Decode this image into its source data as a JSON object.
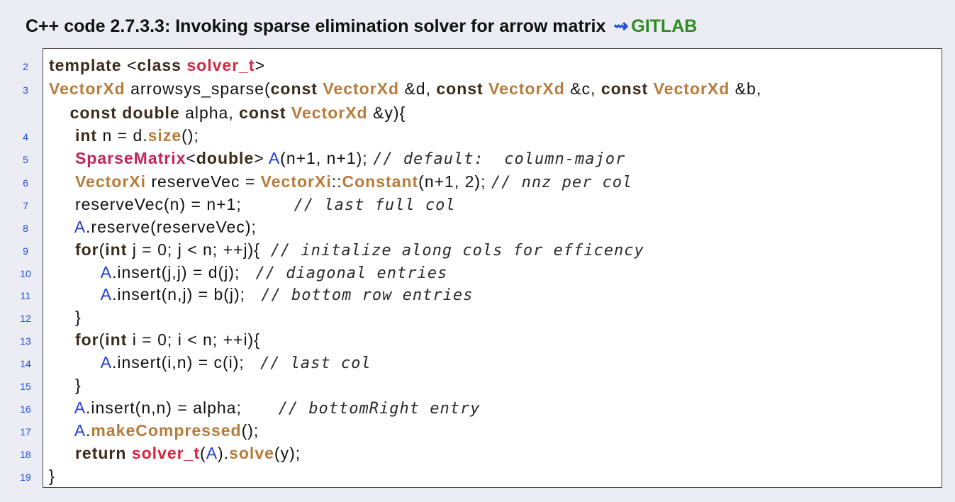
{
  "caption": {
    "label": "C++ code 2.7.3.3: Invoking sparse elimination solver for arrow matrix",
    "arrow": "⇝",
    "link": "GITLAB"
  },
  "lines": [
    {
      "no": "2",
      "html": "<span class=\"kw\">template</span> &lt;<span class=\"kw\">class</span> <span class=\"tp\">solver_t</span>&gt;"
    },
    {
      "no": "3",
      "html": "<span class=\"ty\">VectorXd</span> arrowsys_sparse(<span class=\"kw\">const</span> <span class=\"ty\">VectorXd</span> &amp;d, <span class=\"kw\">const</span> <span class=\"ty\">VectorXd</span> &amp;c, <span class=\"kw\">const</span> <span class=\"ty\">VectorXd</span> &amp;b,"
    },
    {
      "no": "",
      "html": "    <span class=\"kw\">const</span> <span class=\"kw\">double</span> alpha, <span class=\"kw\">const</span> <span class=\"ty\">VectorXd</span> &amp;y){"
    },
    {
      "no": "4",
      "html": "     <span class=\"kw\">int</span> n = d.<span class=\"fn\">size</span>();"
    },
    {
      "no": "5",
      "html": "     <span class=\"sm\">SparseMatrix</span>&lt;<span class=\"kw\">double</span>&gt; <span class=\"ob\">A</span>(n+1, n+1); <span class=\"cm\">// default:  column-major</span>"
    },
    {
      "no": "6",
      "html": "     <span class=\"ty\">VectorXi</span> reserveVec = <span class=\"ty\">VectorXi</span>::<span class=\"fn\">Constant</span>(n+1, 2); <span class=\"cm\">// nnz per col</span>"
    },
    {
      "no": "7",
      "html": "     reserveVec(n) = n+1;          <span class=\"cm\">// last full col</span>"
    },
    {
      "no": "8",
      "html": "     <span class=\"ob\">A</span>.reserve(reserveVec);"
    },
    {
      "no": "9",
      "html": "     <span class=\"kw\">for</span>(<span class=\"kw\">int</span> j = 0; j &lt; n; ++j){  <span class=\"cm\">// initalize along cols for efficency</span>"
    },
    {
      "no": "10",
      "html": "          <span class=\"ob\">A</span>.insert(j,j) = d(j);   <span class=\"cm\">// diagonal entries</span>"
    },
    {
      "no": "11",
      "html": "          <span class=\"ob\">A</span>.insert(n,j) = b(j);   <span class=\"cm\">// bottom row entries</span>"
    },
    {
      "no": "12",
      "html": "     }"
    },
    {
      "no": "13",
      "html": "     <span class=\"kw\">for</span>(<span class=\"kw\">int</span> i = 0; i &lt; n; ++i){"
    },
    {
      "no": "14",
      "html": "          <span class=\"ob\">A</span>.insert(i,n) = c(i);   <span class=\"cm\">// last col</span>"
    },
    {
      "no": "15",
      "html": "     }"
    },
    {
      "no": "16",
      "html": "     <span class=\"ob\">A</span>.insert(n,n) = alpha;       <span class=\"cm\">// bottomRight entry</span>"
    },
    {
      "no": "17",
      "html": "     <span class=\"ob\">A</span>.<span class=\"fn\">makeCompressed</span>();"
    },
    {
      "no": "18",
      "html": "     <span class=\"kw\">return</span> <span class=\"tp\">solver_t</span>(<span class=\"ob\">A</span>).<span class=\"fn\">solve</span>(y);"
    },
    {
      "no": "19",
      "html": "}"
    }
  ]
}
